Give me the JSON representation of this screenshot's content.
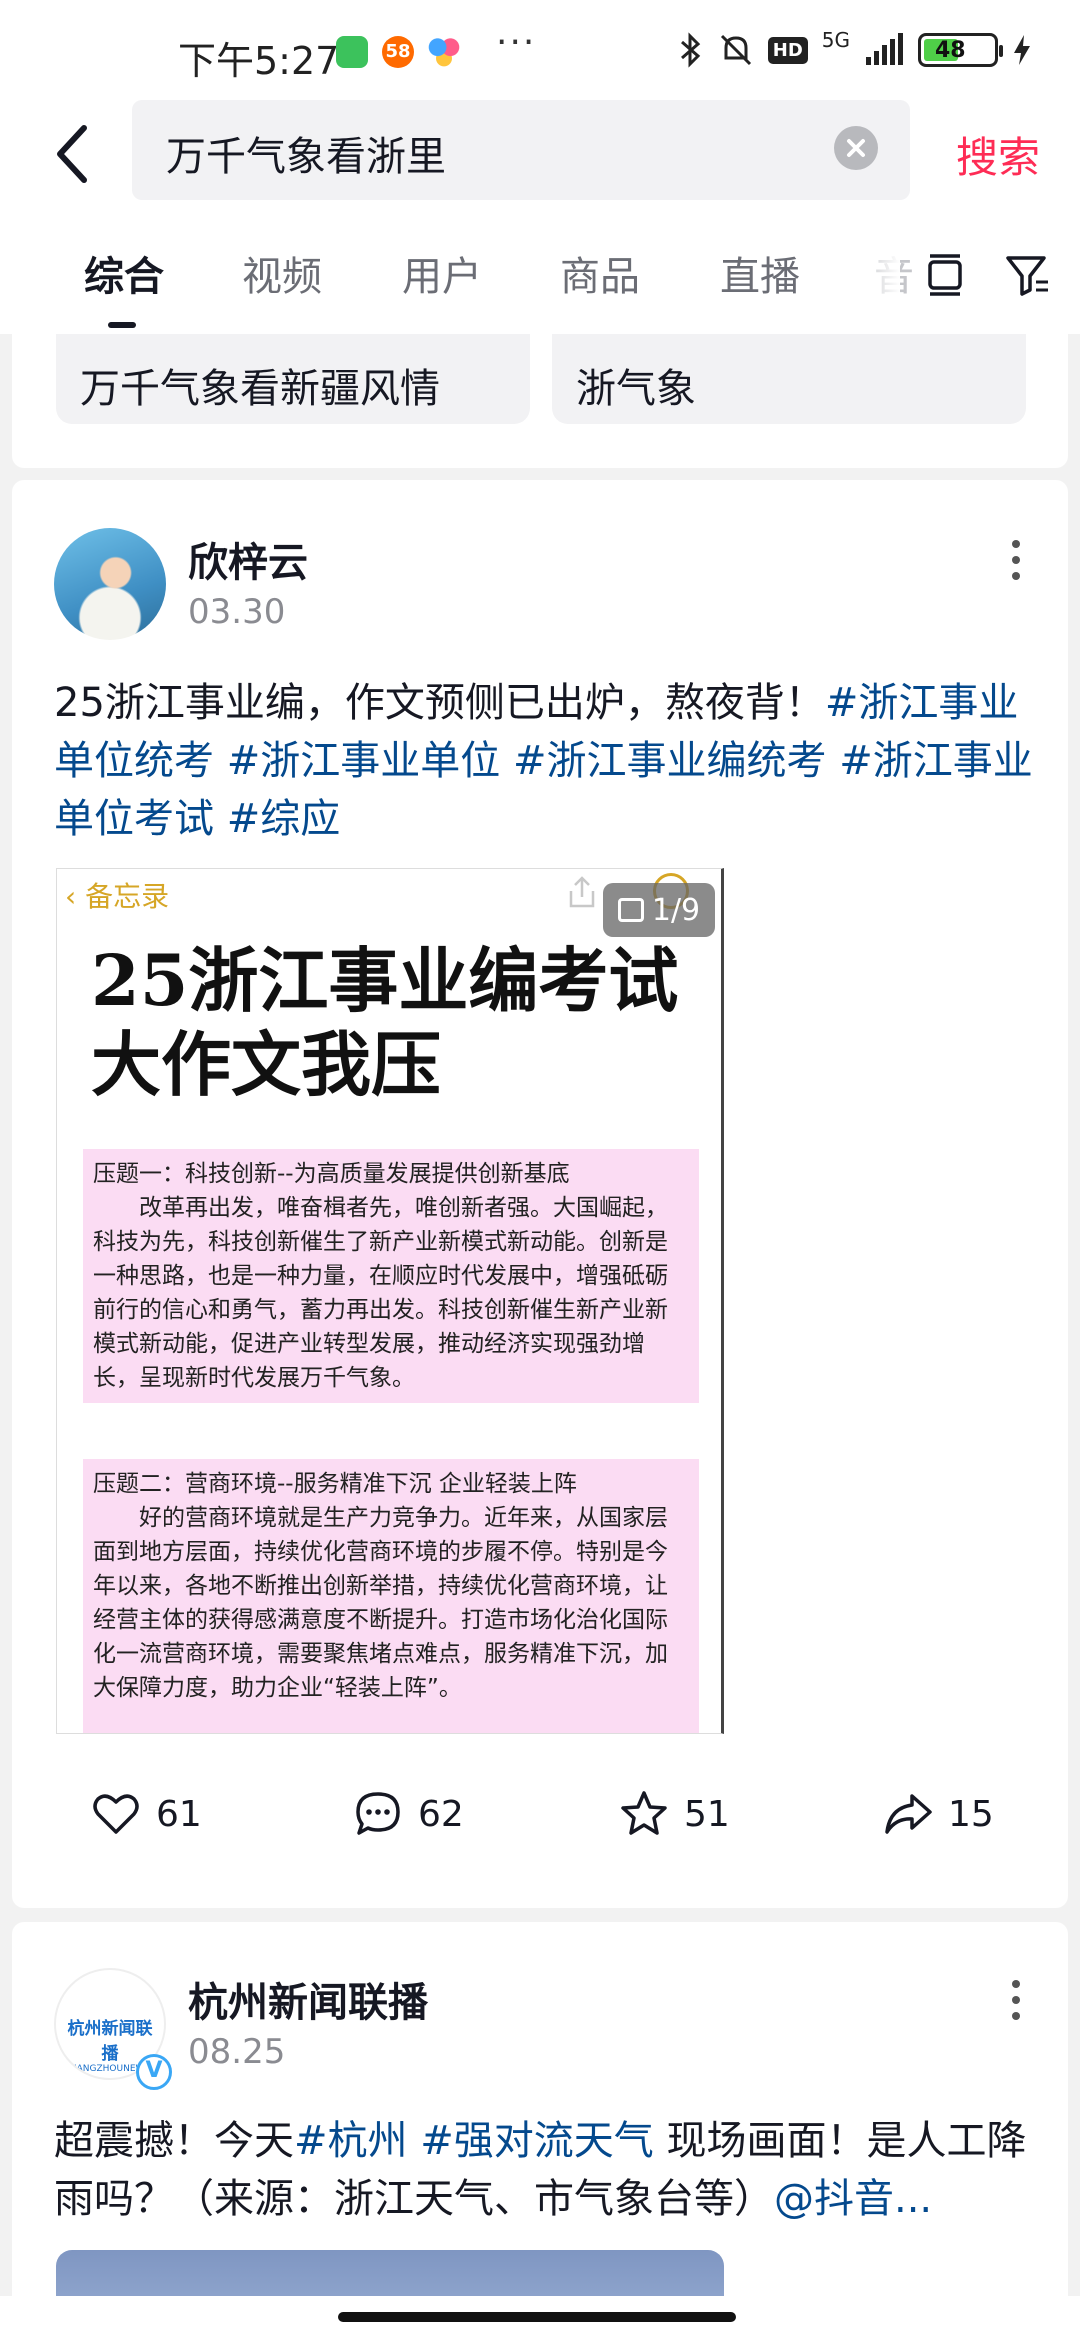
{
  "status_bar": {
    "time": "下午5:27",
    "app_58_label": "58",
    "more": "···",
    "hd": "HD",
    "network": "5G",
    "battery": "48"
  },
  "search": {
    "query": "万千气象看浙里",
    "submit_label": "搜索"
  },
  "tabs": [
    {
      "label": "综合",
      "active": true
    },
    {
      "label": "视频"
    },
    {
      "label": "用户"
    },
    {
      "label": "商品"
    },
    {
      "label": "直播"
    },
    {
      "label": "音"
    }
  ],
  "related": [
    "万千气象看新疆风情",
    "浙气象"
  ],
  "posts": [
    {
      "author": "欣梓云",
      "date": "03.30",
      "text": "25浙江事业编，作文预侧已出炉，熬夜背！",
      "tags": [
        "#浙江事业单位统考",
        "#浙江事业单位",
        "#浙江事业编统考",
        "#浙江事业单位考试",
        "#综应"
      ],
      "image": {
        "back_label": "备忘录",
        "counter": "1/9",
        "title_line1": "25浙江事业编考试",
        "title_line2": "大作文我压",
        "block1_heading": "压题一：科技创新--为高质量发展提供创新基底",
        "block1_body": "改革再出发，唯奋楫者先，唯创新者强。大国崛起，科技为先，科技创新催生了新产业新模式新动能。创新是一种思路，也是一种力量，在顺应时代发展中，增强砥砺前行的信心和勇气，蓄力再出发。科技创新催生新产业新模式新动能，促进产业转型发展，推动经济实现强劲增长，呈现新时代发展万千气象。",
        "block2_heading": "压题二：营商环境--服务精准下沉  企业轻装上阵",
        "block2_body": "好的营商环境就是生产力竞争力。近年来，从国家层面到地方层面，持续优化营商环境的步履不停。特别是今年以来，各地不断推出创新举措，持续优化营商环境，让经营主体的获得感满意度不断提升。打造市场化治化国际化一流营商环境，需要聚焦堵点难点，服务精准下沉，加大保障力度，助力企业“轻装上阵”。"
      },
      "likes": "61",
      "comments": "62",
      "favorites": "51",
      "shares": "15"
    },
    {
      "author": "杭州新闻联播",
      "avatar_logo": "杭州新闻联播",
      "avatar_logo_sub": "HANGZHOUNEWS",
      "verified_mark": "V",
      "date": "08.25",
      "text_before": "超震撼！今天",
      "tag1": "#杭州",
      "tag2": "#强对流天气",
      "text_after": " 现场画面！是人工降雨吗？（来源：浙江天气、市气象台等）",
      "mention": "@抖音..."
    }
  ],
  "colors": {
    "accent": "#fe2c55",
    "tag": "#04498d",
    "memo_highlight": "#fbdcf3",
    "memo_accent": "#d6a626"
  }
}
